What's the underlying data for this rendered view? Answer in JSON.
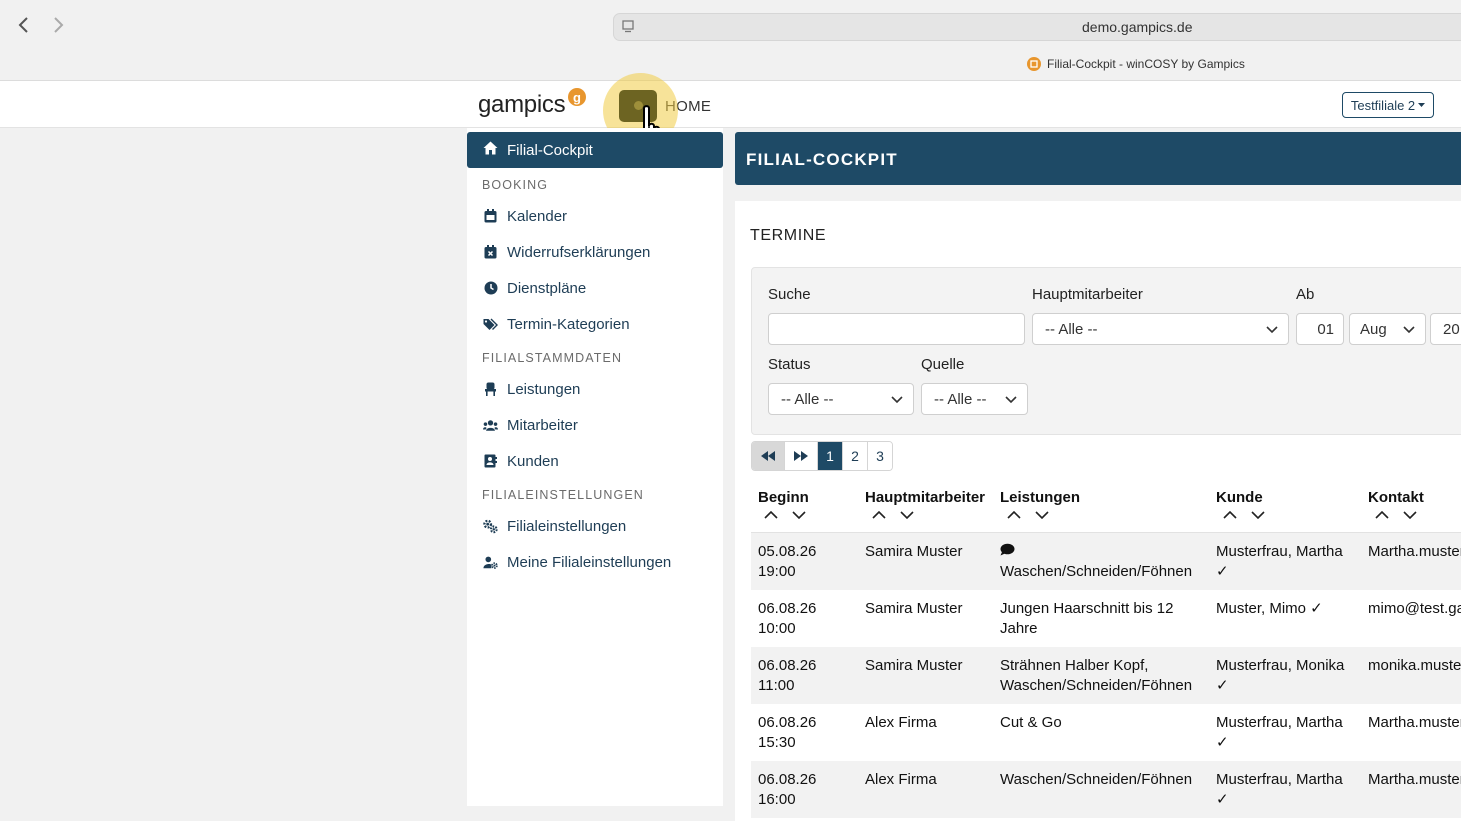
{
  "browser": {
    "url": "demo.gampics.de",
    "tab_title": "Filial-Cockpit - winCOSY by Gampics"
  },
  "header": {
    "logo_text": "gampics",
    "logo_badge": "g",
    "home_label": "HOME",
    "branch_select": "Testfiliale 2"
  },
  "sidebar": {
    "active": "Filial-Cockpit",
    "sections": {
      "booking": "BOOKING",
      "stammdaten": "FILIALSTAMMDATEN",
      "einstellungen": "FILIALEINSTELLUNGEN"
    },
    "items": {
      "kalender": "Kalender",
      "widerruf": "Widerrufserklärungen",
      "dienstplaene": "Dienstpläne",
      "kategorien": "Termin-Kategorien",
      "leistungen": "Leistungen",
      "mitarbeiter": "Mitarbeiter",
      "kunden": "Kunden",
      "filialeinstellungen": "Filialeinstellungen",
      "meine": "Meine Filialeinstellungen"
    }
  },
  "main": {
    "title": "FILIAL-COCKPIT",
    "section_title": "TERMINE",
    "filters": {
      "search_label": "Suche",
      "search_value": "",
      "employee_label": "Hauptmitarbeiter",
      "employee_value": "-- Alle --",
      "from_label": "Ab",
      "from_day": "01",
      "from_month": "Aug",
      "from_year": "20",
      "status_label": "Status",
      "status_value": "-- Alle --",
      "source_label": "Quelle",
      "source_value": "-- Alle --"
    },
    "pagination": {
      "pages": [
        "1",
        "2",
        "3"
      ],
      "current": "1"
    },
    "columns": {
      "begin": "Beginn",
      "employee": "Hauptmitarbeiter",
      "services": "Leistungen",
      "customer": "Kunde",
      "contact": "Kontakt"
    },
    "rows": [
      {
        "date": "05.08.26",
        "time": "19:00",
        "employee": "Samira Muster",
        "services_l1": "",
        "services_l2": "Waschen/Schneiden/Föhnen",
        "customer_l1": "Musterfrau, Martha",
        "customer_l2": "✓",
        "contact": "Martha.muster"
      },
      {
        "date": "06.08.26",
        "time": "10:00",
        "employee": "Samira Muster",
        "services_l1": "Jungen Haarschnitt bis 12",
        "services_l2": "Jahre",
        "customer_l1": "Muster, Mimo ✓",
        "customer_l2": "",
        "contact": "mimo@test.ga"
      },
      {
        "date": "06.08.26",
        "time": "11:00",
        "employee": "Samira Muster",
        "services_l1": "Strähnen Halber Kopf,",
        "services_l2": "Waschen/Schneiden/Föhnen",
        "customer_l1": "Musterfrau, Monika",
        "customer_l2": "✓",
        "contact": "monika.muste"
      },
      {
        "date": "06.08.26",
        "time": "15:30",
        "employee": "Alex Firma",
        "services_l1": "Cut & Go",
        "services_l2": "",
        "customer_l1": "Musterfrau, Martha",
        "customer_l2": "✓",
        "contact": "Martha.muster"
      },
      {
        "date": "06.08.26",
        "time": "16:00",
        "employee": "Alex Firma",
        "services_l1": "Waschen/Schneiden/Föhnen",
        "services_l2": "",
        "customer_l1": "Musterfrau, Martha",
        "customer_l2": "✓",
        "contact": "Martha.muster"
      }
    ]
  }
}
